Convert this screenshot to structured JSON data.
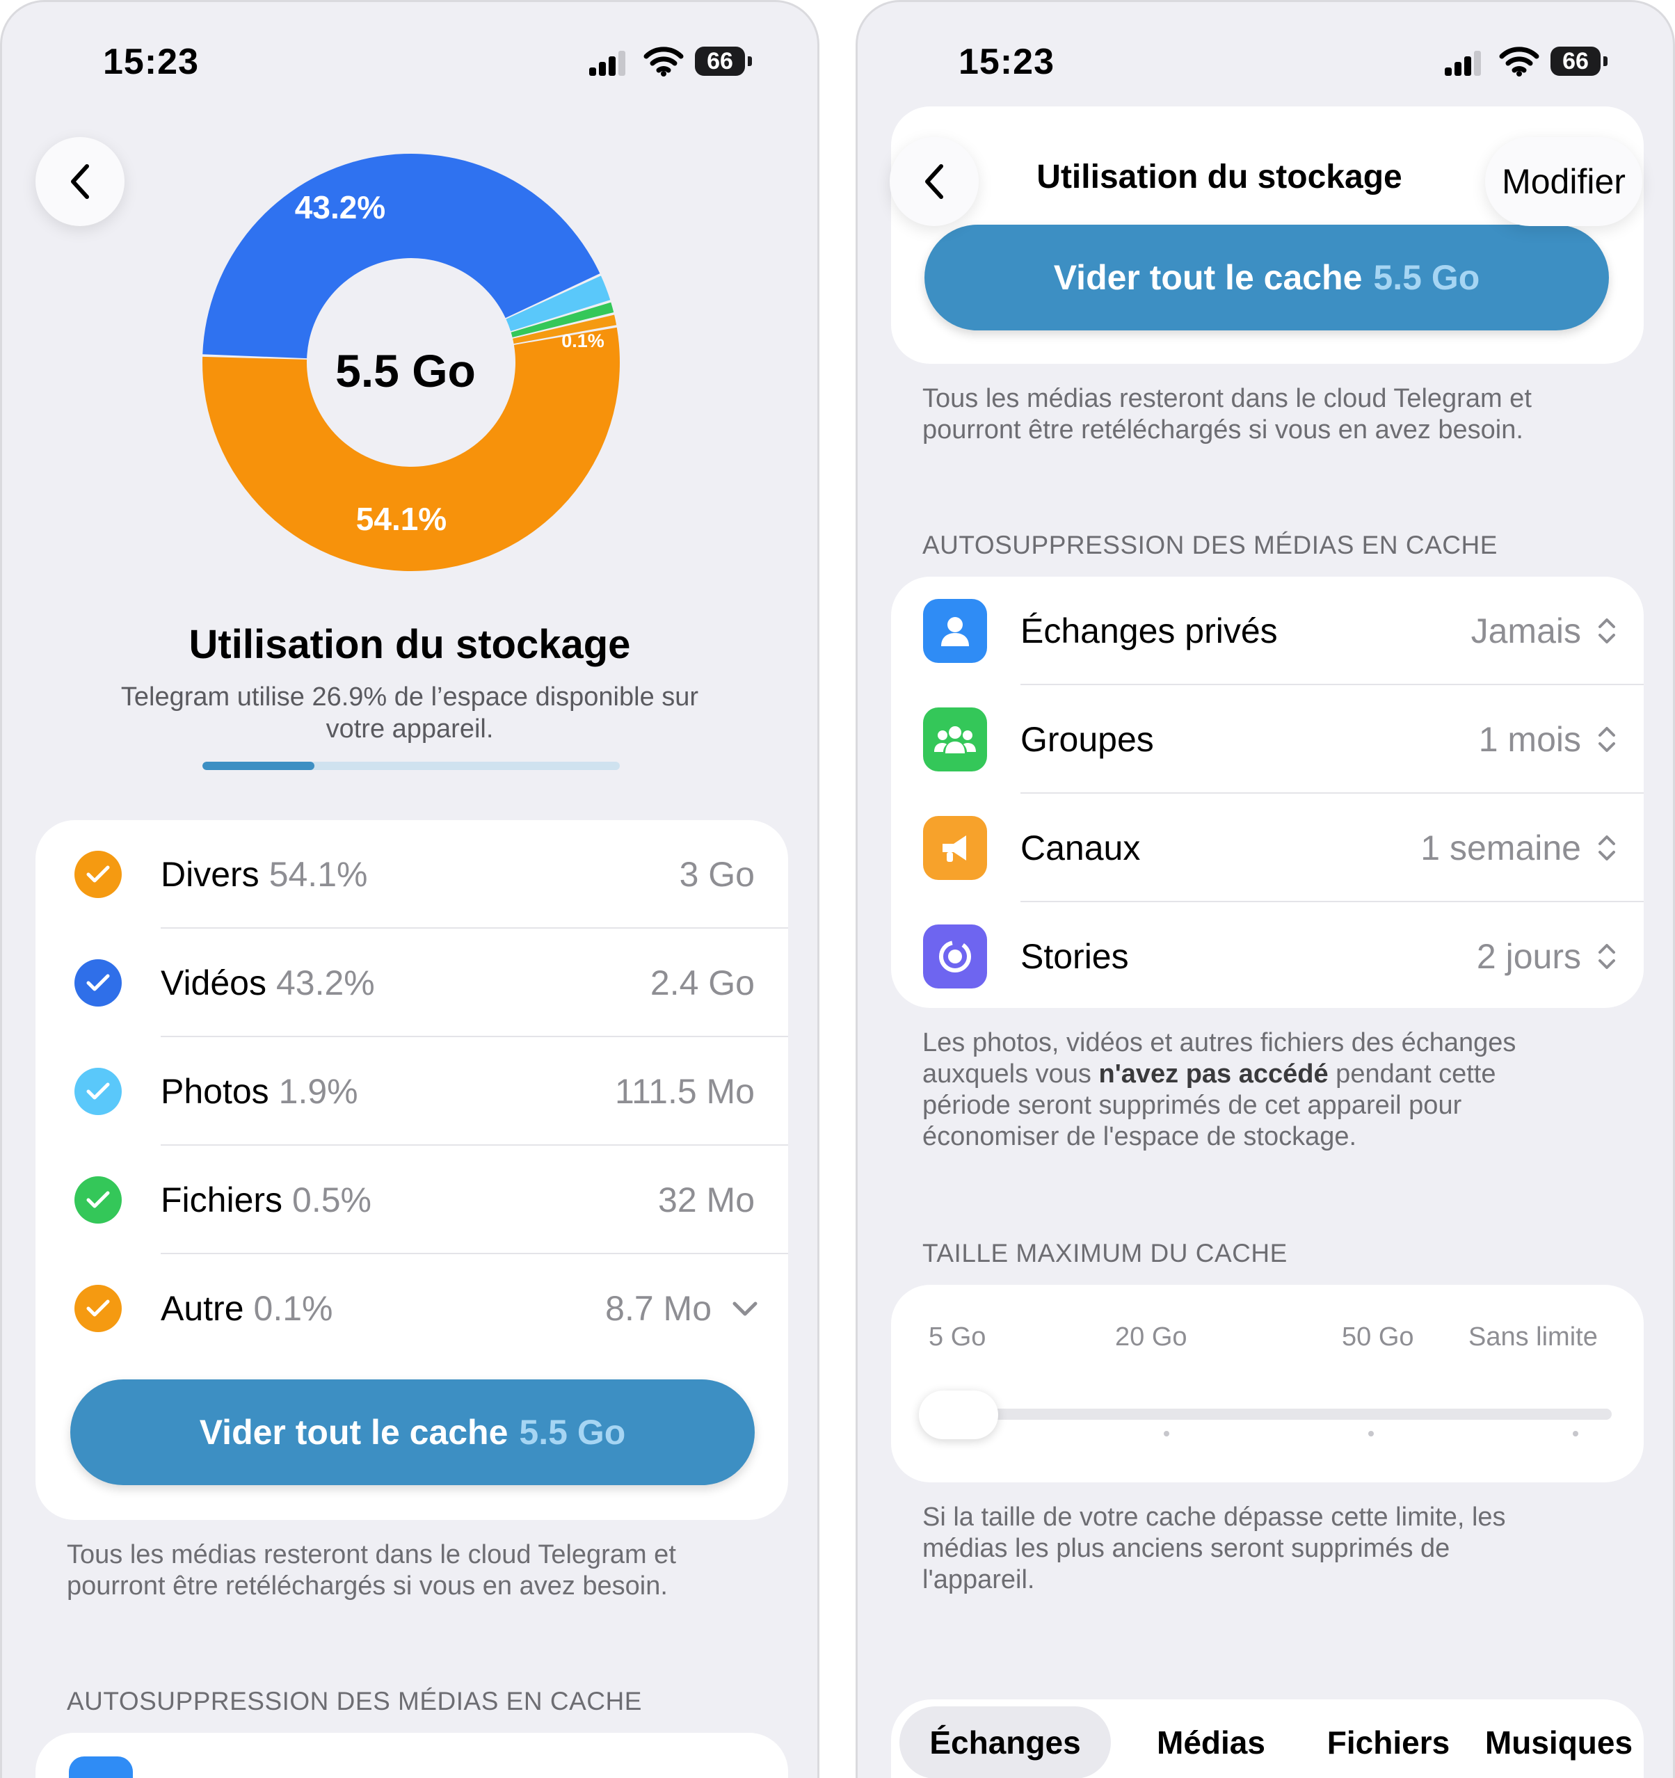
{
  "status_bar": {
    "time": "15:23",
    "battery": "66"
  },
  "left": {
    "chart": {
      "center_label": "5.5 Go",
      "label_videos": "43.2%",
      "label_divers": "54.1%",
      "label_small": "0.1%"
    },
    "title": "Utilisation du stockage",
    "subtitle_line1": "Telegram utilise 26.9% de l’espace disponible sur",
    "subtitle_line2": "votre appareil.",
    "usage_progress": 0.269,
    "categories": [
      {
        "name": "Divers",
        "percent": "54.1%",
        "size": "3 Go",
        "color": "#f59a11"
      },
      {
        "name": "Vidéos",
        "percent": "43.2%",
        "size": "2.4 Go",
        "color": "#2f6fe9"
      },
      {
        "name": "Photos",
        "percent": "1.9%",
        "size": "111.5 Mo",
        "color": "#5ac8fa"
      },
      {
        "name": "Fichiers",
        "percent": "0.5%",
        "size": "32 Mo",
        "color": "#34c759"
      },
      {
        "name": "Autre",
        "percent": "0.1%",
        "size": "8.7 Mo",
        "color": "#f59a11"
      }
    ],
    "clear_button": {
      "label": "Vider tout le cache",
      "size": "5.5 Go"
    },
    "footnote_line1": "Tous les médias resteront dans le cloud Telegram et",
    "footnote_line2": "pourront être retéléchargés si vous en avez besoin.",
    "section_header": "AUTOSUPPRESSION DES MÉDIAS EN CACHE"
  },
  "right": {
    "nav_title": "Utilisation du stockage",
    "edit_label": "Modifier",
    "clear_button": {
      "label": "Vider tout le cache",
      "size": "5.5 Go"
    },
    "footnote_line1": "Tous les médias resteront dans le cloud Telegram et",
    "footnote_line2": "pourront être retéléchargés si vous en avez besoin.",
    "auto_header": "AUTOSUPPRESSION DES MÉDIAS EN CACHE",
    "auto_items": [
      {
        "label": "Échanges privés",
        "value": "Jamais",
        "icon": "person-icon",
        "color": "#2f8cf5"
      },
      {
        "label": "Groupes",
        "value": "1 mois",
        "icon": "group-icon",
        "color": "#34c759"
      },
      {
        "label": "Canaux",
        "value": "1 semaine",
        "icon": "megaphone-icon",
        "color": "#f7a22b"
      },
      {
        "label": "Stories",
        "value": "2 jours",
        "icon": "stories-icon",
        "color": "#6e65f0"
      }
    ],
    "auto_note_line1": "Les photos, vidéos et autres fichiers des échanges",
    "auto_note_line2_pre": "auxquels vous ",
    "auto_note_line2_bold": "n'avez pas accédé",
    "auto_note_line2_post": " pendant cette",
    "auto_note_line3": "période seront supprimés de cet appareil pour",
    "auto_note_line4": "économiser de l'espace de stockage.",
    "cache_header": "TAILLE MAXIMUM DU CACHE",
    "cache_ticks": [
      "5 Go",
      "20 Go",
      "50 Go",
      "Sans limite"
    ],
    "cache_selected": "5 Go",
    "cache_note_line1": "Si la taille de votre cache dépasse cette limite, les",
    "cache_note_line2": "médias les plus anciens seront supprimés de",
    "cache_note_line3": "l'appareil.",
    "tabs": [
      "Échanges",
      "Médias",
      "Fichiers",
      "Musiques"
    ],
    "active_tab": "Échanges"
  }
}
